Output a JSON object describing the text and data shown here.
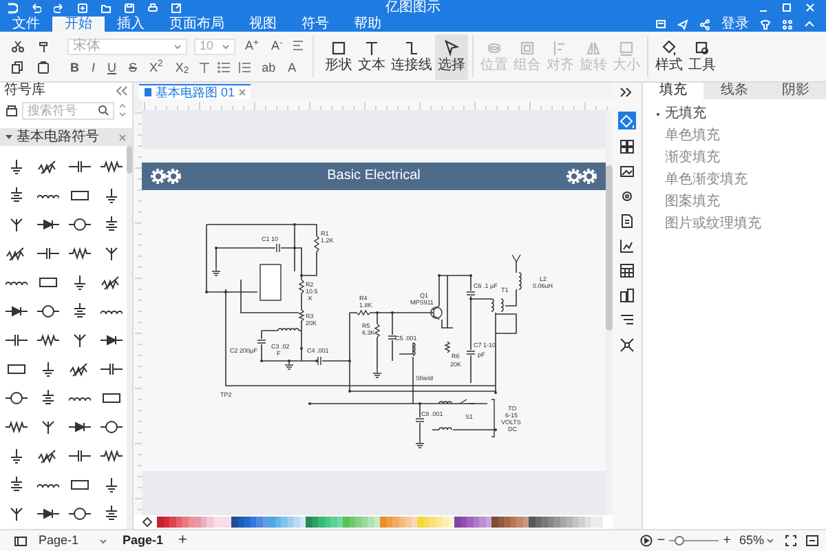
{
  "window": {
    "title": "亿图图示"
  },
  "menu_tabs": [
    {
      "label": "文件",
      "selected": false
    },
    {
      "label": "开始",
      "selected": true
    },
    {
      "label": "插入",
      "selected": false
    },
    {
      "label": "页面布局",
      "selected": false
    },
    {
      "label": "视图",
      "selected": false
    },
    {
      "label": "符号",
      "selected": false
    },
    {
      "label": "帮助",
      "selected": false
    }
  ],
  "account": {
    "login": "登录"
  },
  "ribbon": {
    "font": "宋体",
    "font_size": "10",
    "size_buttons": [
      "A$^{+}$",
      "A$^{-}$"
    ],
    "format_buttons": [
      "B",
      "I",
      "U",
      "S",
      "X$^{2}$",
      "X$_{2}$"
    ],
    "text_buttons": [
      "ab",
      "A"
    ],
    "tools": [
      {
        "kind": "shape",
        "label": "形状",
        "selected": false,
        "disabled": false
      },
      {
        "kind": "text",
        "label": "文本",
        "selected": false,
        "disabled": false
      },
      {
        "kind": "connector",
        "label": "连接线",
        "selected": false,
        "disabled": false
      },
      {
        "kind": "select",
        "label": "选择",
        "selected": true,
        "disabled": false
      },
      {
        "kind": "position",
        "label": "位置",
        "selected": false,
        "disabled": true
      },
      {
        "kind": "group",
        "label": "组合",
        "selected": false,
        "disabled": true
      },
      {
        "kind": "align",
        "label": "对齐",
        "selected": false,
        "disabled": true
      },
      {
        "kind": "rotate",
        "label": "旋转",
        "selected": false,
        "disabled": true
      },
      {
        "kind": "size",
        "label": "大小",
        "selected": false,
        "disabled": true
      },
      {
        "kind": "style",
        "label": "样式",
        "selected": false,
        "disabled": false
      },
      {
        "kind": "tools",
        "label": "工具",
        "selected": false,
        "disabled": false
      }
    ]
  },
  "library": {
    "title": "符号库",
    "search_placeholder": "搜索符号",
    "category": {
      "label": "基本电路符号",
      "expanded": true
    }
  },
  "document_tab": {
    "label": "基本电路图 01"
  },
  "diagram": {
    "title": "Basic Electrical",
    "labels": [
      "R1",
      "1.2K",
      "C1 10",
      "R2",
      "10.5",
      "K",
      "R3",
      "20K",
      "C2 200µF",
      "C3 .02",
      "F",
      "C4 .001",
      "R4",
      "1.8K",
      "R5",
      "6.3K",
      "C5 .001",
      "Q1",
      "MPS911",
      "C6 .1 µF",
      "T1",
      "L2",
      "0.06uH",
      "R6",
      "20K",
      "C7 1-10",
      "pF",
      "Shield",
      "TP2",
      "S1",
      "TO",
      "6-15",
      "VOLTS",
      "DC",
      "C8 .001"
    ]
  },
  "format_panel": {
    "tabs": [
      {
        "label": "填充",
        "selected": true
      },
      {
        "label": "线条",
        "selected": false
      },
      {
        "label": "阴影",
        "selected": false
      }
    ],
    "options": [
      {
        "label": "无填充",
        "selected": true
      },
      {
        "label": "单色填充",
        "selected": false
      },
      {
        "label": "渐变填充",
        "selected": false
      },
      {
        "label": "单色渐变填充",
        "selected": false
      },
      {
        "label": "图案填充",
        "selected": false
      },
      {
        "label": "图片或纹理填充",
        "selected": false
      }
    ]
  },
  "pages": {
    "dropdown": "Page-1",
    "tabs": [
      {
        "label": "Page-1",
        "selected": true
      }
    ],
    "add": "+"
  },
  "zoom": {
    "minus": "−",
    "plus": "+",
    "value": "65%",
    "level": 0.2
  }
}
